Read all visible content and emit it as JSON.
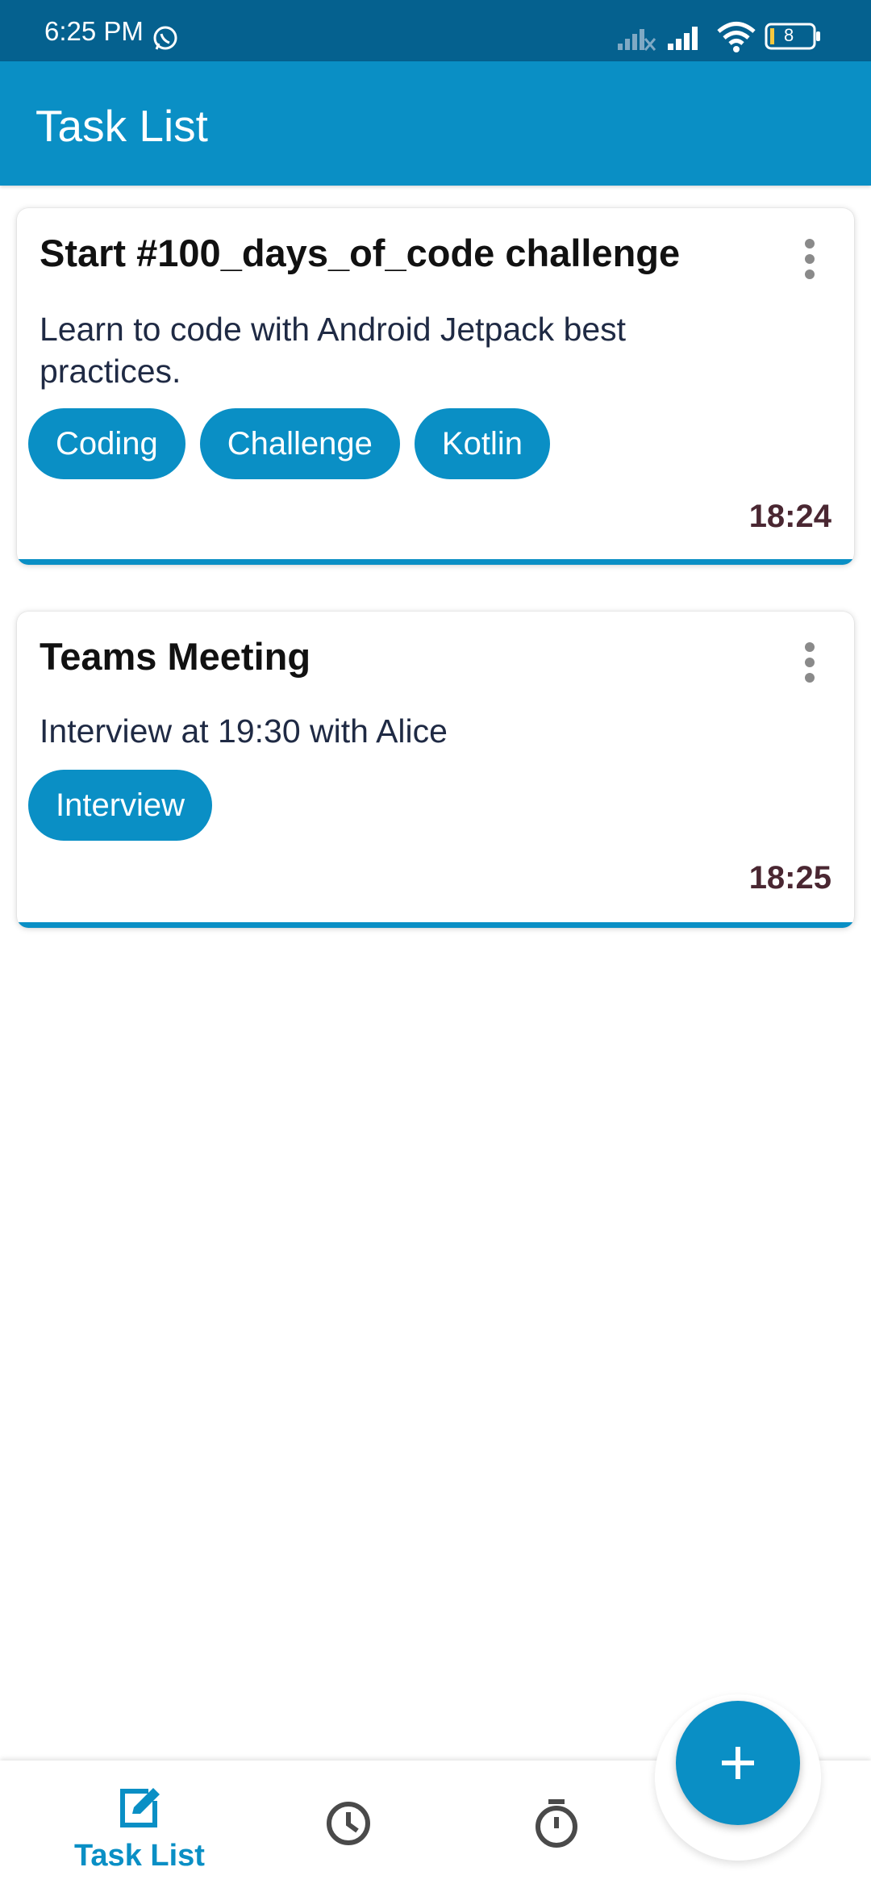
{
  "status_bar": {
    "time": "6:25 PM",
    "icons": [
      "whatsapp-icon",
      "signal-off-icon",
      "signal-icon",
      "wifi-icon",
      "battery-icon"
    ],
    "battery_level": "8"
  },
  "app_bar": {
    "title": "Task List"
  },
  "tasks": [
    {
      "title": "Start #100_days_of_code challenge",
      "description": "Learn to code with Android Jetpack best practices.",
      "tags": [
        "Coding",
        "Challenge",
        "Kotlin"
      ],
      "time": "18:24"
    },
    {
      "title": "Teams Meeting",
      "description": "Interview at 19:30 with Alice",
      "tags": [
        "Interview"
      ],
      "time": "18:25"
    }
  ],
  "bottom_nav": {
    "items": [
      {
        "label": "Task List",
        "icon": "edit-icon",
        "active": true
      },
      {
        "label": "",
        "icon": "clock-icon",
        "active": false
      },
      {
        "label": "",
        "icon": "timer-icon",
        "active": false
      }
    ]
  },
  "fab": {
    "icon": "plus-icon"
  },
  "colors": {
    "primary": "#0a8fc5",
    "status_bar": "#05618f",
    "time_text": "#4a2732"
  }
}
